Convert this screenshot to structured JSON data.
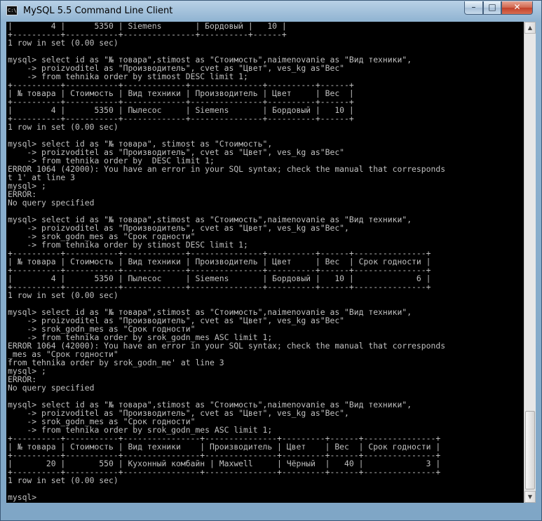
{
  "window": {
    "title": "MySQL 5.5 Command Line Client",
    "icon_label": "C:\\",
    "controls": {
      "minimize": "–",
      "maximize": "□",
      "close": "✕"
    }
  },
  "console": {
    "lines": [
      "|        4 |      5350 | Siemens       | Бордовый |   10 |",
      "+----------+-----------+---------------+----------+------+",
      "1 row in set (0.00 sec)",
      "",
      "mysql> select id as \"№ товара\",stimost as \"Стоимость\",naimenovanie as \"Вид техники\",",
      "    -> proizvoditel as \"Производитель\", cvet as \"Цвет\", ves_kg as\"Вес\"",
      "    -> from tehnika order by stimost DESC limit 1;",
      "+----------+-----------+-------------+---------------+----------+------+",
      "| № товара | Стоимость | Вид техники | Производитель | Цвет     | Вес  |",
      "+----------+-----------+-------------+---------------+----------+------+",
      "|        4 |      5350 | Пылесос     | Siemens       | Бордовый |   10 |",
      "+----------+-----------+-------------+---------------+----------+------+",
      "1 row in set (0.00 sec)",
      "",
      "mysql> select id as \"№ товара\", stimost as \"Стоимость\",",
      "    -> proizvoditel as \"Производитель\", cvet as \"Цвет\", ves_kg as\"Вес\"",
      "    -> from tehnika order by  DESC limit 1;",
      "ERROR 1064 (42000): You have an error in your SQL syntax; check the manual that corresponds",
      "t 1' at line 3",
      "mysql> ;",
      "ERROR:",
      "No query specified",
      "",
      "mysql> select id as \"№ товара\",stimost as \"Стоимость\",naimenovanie as \"Вид техники\",",
      "    -> proizvoditel as \"Производитель\", cvet as \"Цвет\", ves_kg as\"Вес\",",
      "    -> srok_godn_mes as \"Срок годности\"",
      "    -> from tehnika order by stimost DESC limit 1;",
      "+----------+-----------+-------------+---------------+----------+------+---------------+",
      "| № товара | Стоимость | Вид техники | Производитель | Цвет     | Вес  | Срок годности |",
      "+----------+-----------+-------------+---------------+----------+------+---------------+",
      "|        4 |      5350 | Пылесос     | Siemens       | Бордовый |   10 |             6 |",
      "+----------+-----------+-------------+---------------+----------+------+---------------+",
      "1 row in set (0.00 sec)",
      "",
      "mysql> select id as \"№ товара\",stimost as \"Стоимость\",naimenovanie as \"Вид техники\",",
      "    -> proizvoditel as \"Производитель\", cvet as \"Цвет\", ves_kg as\"Вес\"",
      "    -> srok_godn_mes as \"Срок годности\"",
      "    -> from tehnika order by srok_godn_mes ASC limit 1;",
      "ERROR 1064 (42000): You have an error in your SQL syntax; check the manual that corresponds",
      "_mes as \"Срок годности\"",
      "from tehnika order by srok_godn_me' at line 3",
      "mysql> ;",
      "ERROR:",
      "No query specified",
      "",
      "mysql> select id as \"№ товара\",stimost as \"Стоимость\",naimenovanie as \"Вид техники\",",
      "    -> proizvoditel as \"Производитель\", cvet as \"Цвет\", ves_kg as\"Вес\",",
      "    -> srok_godn_mes as \"Срок годности\"",
      "    -> from tehnika order by srok_godn_mes ASC limit 1;",
      "+----------+-----------+----------------+---------------+---------+------+---------------+",
      "| № товара | Стоимость | Вид техники    | Производитель | Цвет    | Вес  | Срок годности |",
      "+----------+-----------+----------------+---------------+---------+------+---------------+",
      "|       20 |       550 | Кухонный комбайн | Maxwell     | Чёрный  |   40 |             3 |",
      "+----------+-----------+----------------+---------------+---------+------+---------------+",
      "1 row in set (0.00 sec)",
      "",
      "mysql>"
    ]
  },
  "colors": {
    "console_bg": "#000000",
    "console_text": "#c0c0c0"
  },
  "scrollbar": {
    "up": "▲",
    "down": "▼"
  }
}
